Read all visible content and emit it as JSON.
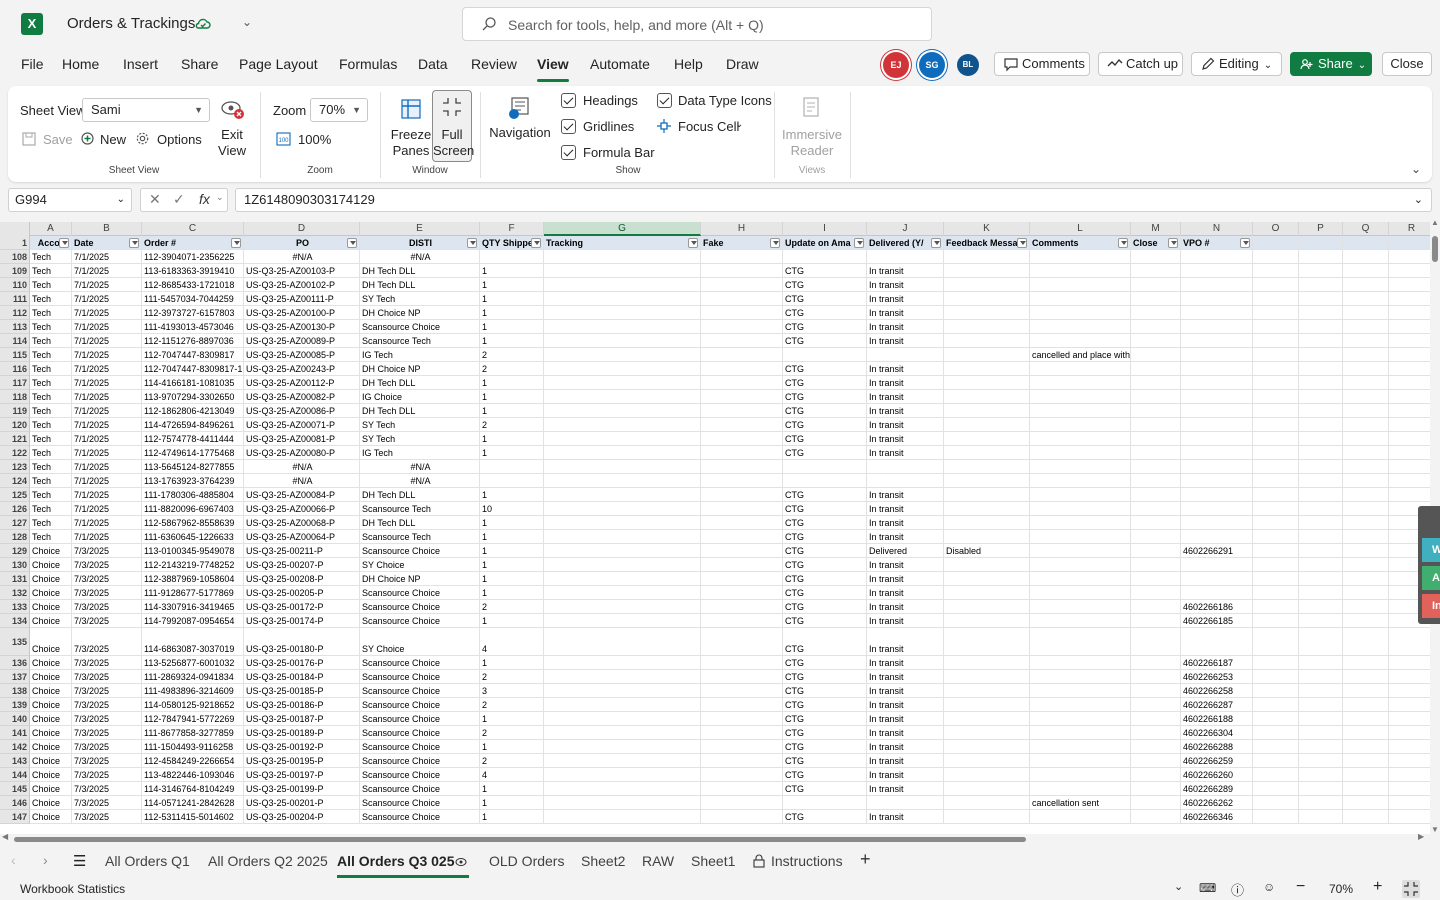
{
  "app": {
    "title": "Orders & Trackings",
    "search_placeholder": "Search for tools, help, and more (Alt + Q)"
  },
  "menu": [
    "File",
    "Home",
    "Insert",
    "Share",
    "Page Layout",
    "Formulas",
    "Data",
    "Review",
    "View",
    "Automate",
    "Help",
    "Draw"
  ],
  "menu_active": "View",
  "collaborators": [
    "EJ",
    "SG",
    "BL"
  ],
  "toolbar": {
    "comments": "Comments",
    "catchup": "Catch up",
    "editing": "Editing",
    "share": "Share",
    "close": "Close"
  },
  "ribbon": {
    "sheet_view_label": "Sheet View",
    "sheet_view_value": "Sami",
    "save": "Save",
    "new": "New",
    "options": "Options",
    "exit_view": "Exit View",
    "group_sheet_view": "Sheet View",
    "zoom_label": "Zoom",
    "zoom_value": "70%",
    "zoom_100": "100%",
    "group_zoom": "Zoom",
    "freeze_panes": "Freeze Panes",
    "full_screen": "Full Screen",
    "group_window": "Window",
    "navigation": "Navigation",
    "headings": "Headings",
    "gridlines": "Gridlines",
    "formula_bar": "Formula Bar",
    "data_type_icons": "Data Type Icons",
    "focus_cell": "Focus Cell",
    "group_show": "Show",
    "immersive_reader": "Immersive Reader",
    "group_views": "Views"
  },
  "formula_bar": {
    "name_box": "G994",
    "formula": "1Z6148090303174129"
  },
  "sheet": {
    "columns": [
      "A",
      "B",
      "C",
      "D",
      "E",
      "F",
      "G",
      "H",
      "I",
      "J",
      "K",
      "L",
      "M",
      "N",
      "O",
      "P",
      "Q",
      "R"
    ],
    "selected_column": "G",
    "headers": [
      "Accou",
      "Date",
      "Order #",
      "PO",
      "DISTI",
      "QTY Shippe",
      "Tracking",
      "Fake",
      "Update on Ama",
      "Delivered (Y/",
      "Feedback Messa",
      "Comments",
      "Close",
      "VPO #"
    ],
    "header_row_number": "1",
    "rows": [
      {
        "n": "108",
        "c": [
          "Tech",
          "7/1/2025",
          "112-3904071-2356225",
          "#N/A",
          "#N/A",
          "",
          "",
          "",
          "",
          "",
          "",
          "",
          "",
          ""
        ]
      },
      {
        "n": "109",
        "c": [
          "Tech",
          "7/1/2025",
          "113-6183363-3919410",
          "US-Q3-25-AZ00103-P",
          "DH Tech DLL",
          "1",
          "",
          "",
          "CTG",
          "In transit",
          "",
          "",
          "",
          ""
        ]
      },
      {
        "n": "110",
        "c": [
          "Tech",
          "7/1/2025",
          "112-8685433-1721018",
          "US-Q3-25-AZ00102-P",
          "DH Tech DLL",
          "1",
          "",
          "",
          "CTG",
          "In transit",
          "",
          "",
          "",
          ""
        ]
      },
      {
        "n": "111",
        "c": [
          "Tech",
          "7/1/2025",
          "111-5457034-7044259",
          "US-Q3-25-AZ00111-P",
          "SY Tech",
          "1",
          "",
          "",
          "CTG",
          "In transit",
          "",
          "",
          "",
          ""
        ]
      },
      {
        "n": "112",
        "c": [
          "Tech",
          "7/1/2025",
          "112-3973727-6157803",
          "US-Q3-25-AZ00100-P",
          "DH Choice NP",
          "1",
          "",
          "",
          "CTG",
          "In transit",
          "",
          "",
          "",
          ""
        ]
      },
      {
        "n": "113",
        "c": [
          "Tech",
          "7/1/2025",
          "111-4193013-4573046",
          "US-Q3-25-AZ00130-P",
          "Scansource Choice",
          "1",
          "",
          "",
          "CTG",
          "In transit",
          "",
          "",
          "",
          ""
        ]
      },
      {
        "n": "114",
        "c": [
          "Tech",
          "7/1/2025",
          "112-1151276-8897036",
          "US-Q3-25-AZ00089-P",
          "Scansource Tech",
          "1",
          "",
          "",
          "CTG",
          "In transit",
          "",
          "",
          "",
          ""
        ]
      },
      {
        "n": "115",
        "c": [
          "Tech",
          "7/1/2025",
          "112-7047447-8309817",
          "US-Q3-25-AZ00085-P",
          "IG Tech",
          "2",
          "",
          "",
          "",
          "",
          "",
          "cancelled and place with dh",
          "",
          ""
        ]
      },
      {
        "n": "116",
        "c": [
          "Tech",
          "7/1/2025",
          "112-7047447-8309817-1",
          "US-Q3-25-AZ00243-P",
          "DH Choice NP",
          "2",
          "",
          "",
          "CTG",
          "In transit",
          "",
          "",
          "",
          ""
        ]
      },
      {
        "n": "117",
        "c": [
          "Tech",
          "7/1/2025",
          "114-4166181-1081035",
          "US-Q3-25-AZ00112-P",
          "DH Tech DLL",
          "1",
          "",
          "",
          "CTG",
          "In transit",
          "",
          "",
          "",
          ""
        ]
      },
      {
        "n": "118",
        "c": [
          "Tech",
          "7/1/2025",
          "113-9707294-3302650",
          "US-Q3-25-AZ00082-P",
          "IG Choice",
          "1",
          "",
          "",
          "CTG",
          "In transit",
          "",
          "",
          "",
          ""
        ]
      },
      {
        "n": "119",
        "c": [
          "Tech",
          "7/1/2025",
          "112-1862806-4213049",
          "US-Q3-25-AZ00086-P",
          "DH Tech DLL",
          "1",
          "",
          "",
          "CTG",
          "In transit",
          "",
          "",
          "",
          ""
        ]
      },
      {
        "n": "120",
        "c": [
          "Tech",
          "7/1/2025",
          "114-4726594-8496261",
          "US-Q3-25-AZ00071-P",
          "SY Tech",
          "2",
          "",
          "",
          "CTG",
          "In transit",
          "",
          "",
          "",
          ""
        ]
      },
      {
        "n": "121",
        "c": [
          "Tech",
          "7/1/2025",
          "112-7574778-4411444",
          "US-Q3-25-AZ00081-P",
          "SY Tech",
          "1",
          "",
          "",
          "CTG",
          "In transit",
          "",
          "",
          "",
          ""
        ]
      },
      {
        "n": "122",
        "c": [
          "Tech",
          "7/1/2025",
          "112-4749614-1775468",
          "US-Q3-25-AZ00080-P",
          "IG Tech",
          "1",
          "",
          "",
          "CTG",
          "In transit",
          "",
          "",
          "",
          ""
        ]
      },
      {
        "n": "123",
        "c": [
          "Tech",
          "7/1/2025",
          "113-5645124-8277855",
          "#N/A",
          "#N/A",
          "",
          "",
          "",
          "",
          "",
          "",
          "",
          "",
          ""
        ]
      },
      {
        "n": "124",
        "c": [
          "Tech",
          "7/1/2025",
          "113-1763923-3764239",
          "#N/A",
          "#N/A",
          "",
          "",
          "",
          "",
          "",
          "",
          "",
          "",
          ""
        ]
      },
      {
        "n": "125",
        "c": [
          "Tech",
          "7/1/2025",
          "111-1780306-4885804",
          "US-Q3-25-AZ00084-P",
          "DH Tech DLL",
          "1",
          "",
          "",
          "CTG",
          "In transit",
          "",
          "",
          "",
          ""
        ]
      },
      {
        "n": "126",
        "c": [
          "Tech",
          "7/1/2025",
          "111-8820096-6967403",
          "US-Q3-25-AZ00066-P",
          "Scansource Tech",
          "10",
          "",
          "",
          "CTG",
          "In transit",
          "",
          "",
          "",
          ""
        ]
      },
      {
        "n": "127",
        "c": [
          "Tech",
          "7/1/2025",
          "112-5867962-8558639",
          "US-Q3-25-AZ00068-P",
          "DH Tech DLL",
          "1",
          "",
          "",
          "CTG",
          "In transit",
          "",
          "",
          "",
          ""
        ]
      },
      {
        "n": "128",
        "c": [
          "Tech",
          "7/1/2025",
          "111-6360645-1226633",
          "US-Q3-25-AZ00064-P",
          "Scansource Tech",
          "1",
          "",
          "",
          "CTG",
          "In transit",
          "",
          "",
          "",
          ""
        ]
      },
      {
        "n": "129",
        "c": [
          "Choice",
          "7/3/2025",
          "113-0100345-9549078",
          "US-Q3-25-00211-P",
          "Scansource Choice",
          "1",
          "",
          "",
          "CTG",
          "Delivered",
          "Disabled",
          "",
          "",
          "4602266291"
        ]
      },
      {
        "n": "130",
        "c": [
          "Choice",
          "7/3/2025",
          "112-2143219-7748252",
          "US-Q3-25-00207-P",
          "SY Choice",
          "1",
          "",
          "",
          "CTG",
          "In transit",
          "",
          "",
          "",
          ""
        ]
      },
      {
        "n": "131",
        "c": [
          "Choice",
          "7/3/2025",
          "112-3887969-1058604",
          "US-Q3-25-00208-P",
          "DH Choice NP",
          "1",
          "",
          "",
          "CTG",
          "In transit",
          "",
          "",
          "",
          ""
        ]
      },
      {
        "n": "132",
        "c": [
          "Choice",
          "7/3/2025",
          "111-9128677-5177869",
          "US-Q3-25-00205-P",
          "Scansource Choice",
          "1",
          "",
          "",
          "CTG",
          "In transit",
          "",
          "",
          "",
          ""
        ]
      },
      {
        "n": "133",
        "c": [
          "Choice",
          "7/3/2025",
          "114-3307916-3419465",
          "US-Q3-25-00172-P",
          "Scansource Choice",
          "2",
          "",
          "",
          "CTG",
          "In transit",
          "",
          "",
          "",
          "4602266186"
        ]
      },
      {
        "n": "134",
        "c": [
          "Choice",
          "7/3/2025",
          "114-7992087-0954654",
          "US-Q3-25-00174-P",
          "Scansource Choice",
          "1",
          "",
          "",
          "CTG",
          "In transit",
          "",
          "",
          "",
          "4602266185"
        ]
      },
      {
        "n": "135",
        "tall": true,
        "c": [
          "Choice",
          "7/3/2025",
          "114-6863087-3037019",
          "US-Q3-25-00180-P",
          "SY Choice",
          "4",
          "",
          "",
          "CTG",
          "In transit",
          "",
          "",
          "",
          ""
        ]
      },
      {
        "n": "136",
        "c": [
          "Choice",
          "7/3/2025",
          "113-5256877-6001032",
          "US-Q3-25-00176-P",
          "Scansource Choice",
          "1",
          "",
          "",
          "CTG",
          "In transit",
          "",
          "",
          "",
          "4602266187"
        ]
      },
      {
        "n": "137",
        "c": [
          "Choice",
          "7/3/2025",
          "111-2869324-0941834",
          "US-Q3-25-00184-P",
          "Scansource Choice",
          "2",
          "",
          "",
          "CTG",
          "In transit",
          "",
          "",
          "",
          "4602266253"
        ]
      },
      {
        "n": "138",
        "c": [
          "Choice",
          "7/3/2025",
          "111-4983896-3214609",
          "US-Q3-25-00185-P",
          "Scansource Choice",
          "3",
          "",
          "",
          "CTG",
          "In transit",
          "",
          "",
          "",
          "4602266258"
        ]
      },
      {
        "n": "139",
        "c": [
          "Choice",
          "7/3/2025",
          "114-0580125-9218652",
          "US-Q3-25-00186-P",
          "Scansource Choice",
          "2",
          "",
          "",
          "CTG",
          "In transit",
          "",
          "",
          "",
          "4602266287"
        ]
      },
      {
        "n": "140",
        "c": [
          "Choice",
          "7/3/2025",
          "112-7847941-5772269",
          "US-Q3-25-00187-P",
          "Scansource Choice",
          "1",
          "",
          "",
          "CTG",
          "In transit",
          "",
          "",
          "",
          "4602266188"
        ]
      },
      {
        "n": "141",
        "c": [
          "Choice",
          "7/3/2025",
          "111-8677858-3277859",
          "US-Q3-25-00189-P",
          "Scansource Choice",
          "2",
          "",
          "",
          "CTG",
          "In transit",
          "",
          "",
          "",
          "4602266304"
        ]
      },
      {
        "n": "142",
        "c": [
          "Choice",
          "7/3/2025",
          "111-1504493-9116258",
          "US-Q3-25-00192-P",
          "Scansource Choice",
          "1",
          "",
          "",
          "CTG",
          "In transit",
          "",
          "",
          "",
          "4602266288"
        ]
      },
      {
        "n": "143",
        "c": [
          "Choice",
          "7/3/2025",
          "112-4584249-2266654",
          "US-Q3-25-00195-P",
          "Scansource Choice",
          "2",
          "",
          "",
          "CTG",
          "In transit",
          "",
          "",
          "",
          "4602266259"
        ]
      },
      {
        "n": "144",
        "c": [
          "Choice",
          "7/3/2025",
          "113-4822446-1093046",
          "US-Q3-25-00197-P",
          "Scansource Choice",
          "4",
          "",
          "",
          "CTG",
          "In transit",
          "",
          "",
          "",
          "4602266260"
        ]
      },
      {
        "n": "145",
        "c": [
          "Choice",
          "7/3/2025",
          "114-3146764-8104249",
          "US-Q3-25-00199-P",
          "Scansource Choice",
          "1",
          "",
          "",
          "CTG",
          "In transit",
          "",
          "",
          "",
          "4602266289"
        ]
      },
      {
        "n": "146",
        "c": [
          "Choice",
          "7/3/2025",
          "114-0571241-2842628",
          "US-Q3-25-00201-P",
          "Scansource Choice",
          "1",
          "",
          "",
          "",
          "",
          "",
          "cancellation sent",
          "",
          "4602266262"
        ]
      },
      {
        "n": "147",
        "c": [
          "Choice",
          "7/3/2025",
          "112-5311415-5014602",
          "US-Q3-25-00204-P",
          "Scansource Choice",
          "1",
          "",
          "",
          "CTG",
          "In transit",
          "",
          "",
          "",
          "4602266346"
        ]
      }
    ]
  },
  "side_panel": [
    "W",
    "A",
    "In"
  ],
  "sheet_tabs": [
    "All Orders Q1",
    "All Orders Q2 2025",
    "All Orders Q3 025",
    "OLD Orders",
    "Sheet2",
    "RAW",
    "Sheet1",
    "Instructions"
  ],
  "active_sheet": "All Orders Q3 025",
  "status": {
    "left": "Workbook Statistics",
    "zoom": "70%"
  },
  "colors": {
    "accent": "#107c41",
    "header_fill": "#dde6f0",
    "avatar_ej": "#d13438",
    "avatar_sg": "#0f6cbd",
    "avatar_bl": "#0f548c"
  }
}
